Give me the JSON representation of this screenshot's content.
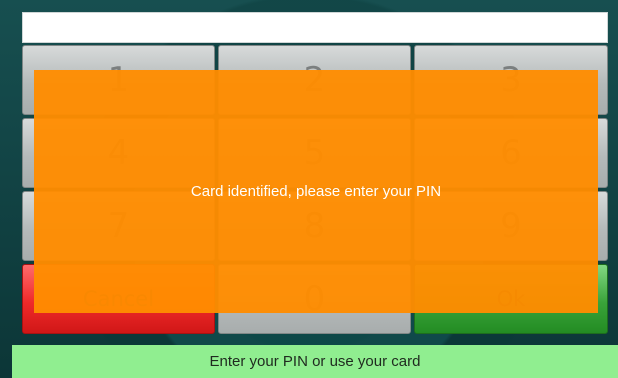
{
  "pin_field": {
    "value": ""
  },
  "keypad": {
    "keys": [
      {
        "label": "1"
      },
      {
        "label": "2"
      },
      {
        "label": "3"
      },
      {
        "label": "4"
      },
      {
        "label": "5"
      },
      {
        "label": "6"
      },
      {
        "label": "7"
      },
      {
        "label": "8"
      },
      {
        "label": "9"
      },
      {
        "label": "Cancel"
      },
      {
        "label": "0"
      },
      {
        "label": "Ok"
      }
    ]
  },
  "overlay": {
    "message": "Card identified, please enter your PIN"
  },
  "status": {
    "message": "Enter your PIN or use your card"
  },
  "colors": {
    "overlay": "#ff8c00",
    "status_bar": "#90ee90",
    "cancel": "#ef2a2a",
    "ok": "#3aa33a"
  }
}
